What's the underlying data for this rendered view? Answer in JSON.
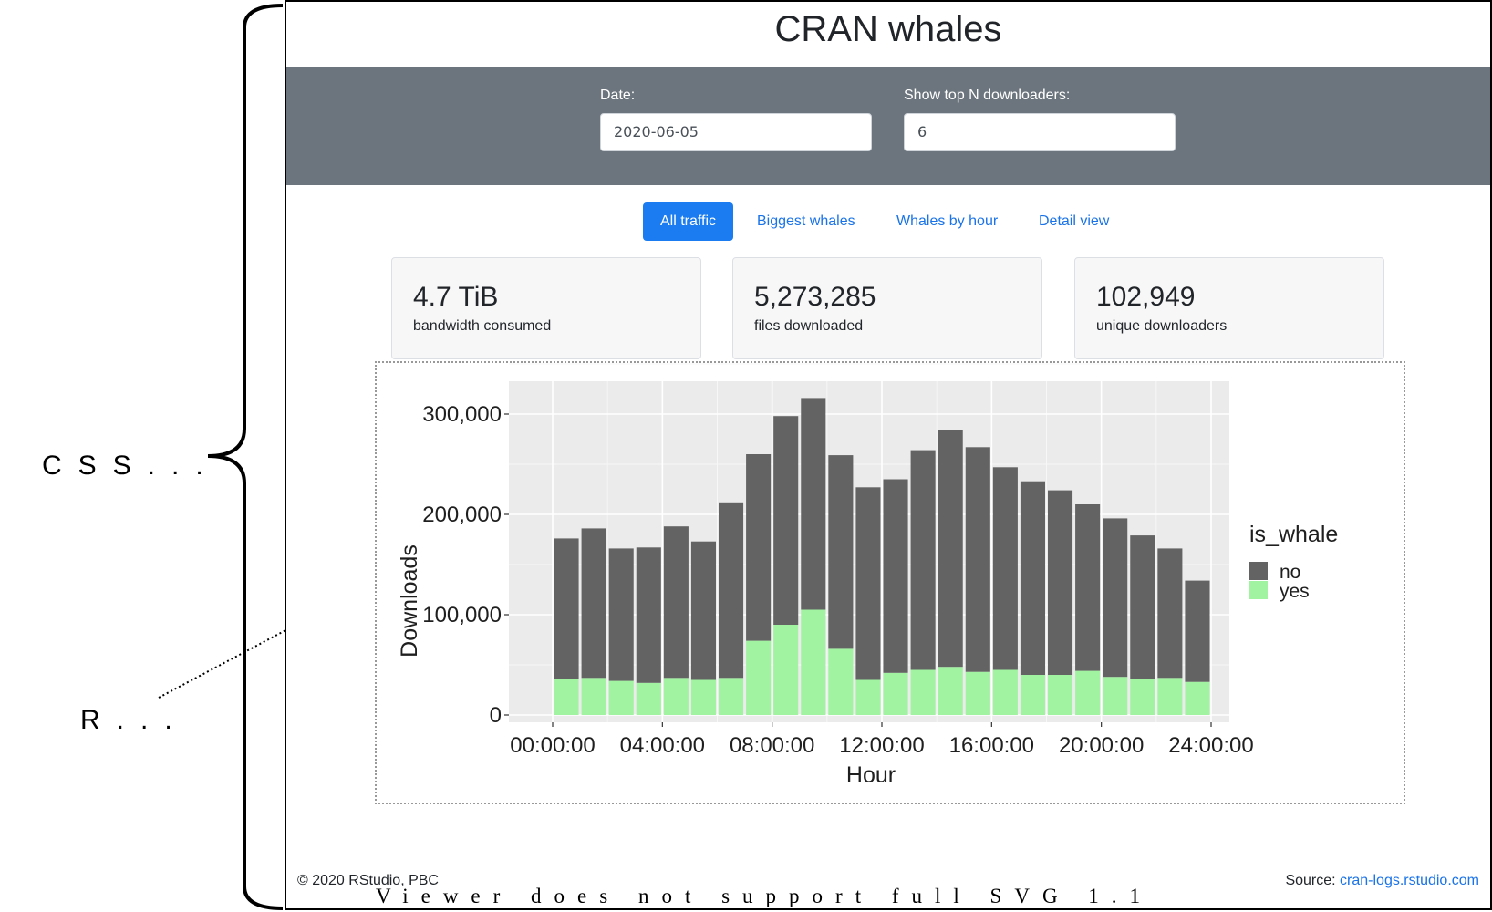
{
  "annotations": {
    "css": "CSS...",
    "r": "R..."
  },
  "app": {
    "title": "CRAN whales",
    "date_label": "Date:",
    "date_value": "2020-06-05",
    "topn_label": "Show top N downloaders:",
    "topn_value": "6",
    "tabs": [
      "All traffic",
      "Biggest whales",
      "Whales by hour",
      "Detail view"
    ],
    "active_tab": "All traffic",
    "cards": [
      {
        "value": "4.7 TiB",
        "label": "bandwidth consumed"
      },
      {
        "value": "5,273,285",
        "label": "files downloaded"
      },
      {
        "value": "102,949",
        "label": "unique downloaders"
      }
    ],
    "footer": {
      "copyright": "© 2020 RStudio, PBC",
      "svg_warning": "Viewer does not support full SVG 1.1",
      "source_label": "Source:",
      "source_link": "cran-logs.rstudio.com"
    }
  },
  "chart_data": {
    "type": "bar",
    "stacked": true,
    "xlabel": "Hour",
    "ylabel": "Downloads",
    "ylim": [
      0,
      330000
    ],
    "xlim": [
      -1,
      24
    ],
    "yticks": [
      0,
      100000,
      200000,
      300000
    ],
    "ytick_labels": [
      "0",
      "100,000",
      "200,000",
      "300,000"
    ],
    "xticks": [
      0,
      4,
      8,
      12,
      16,
      20,
      24
    ],
    "xtick_labels": [
      "00:00:00",
      "04:00:00",
      "08:00:00",
      "12:00:00",
      "16:00:00",
      "20:00:00",
      "24:00:00"
    ],
    "legend_title": "is_whale",
    "legend_position": "right",
    "x": [
      0.5,
      1.5,
      2.5,
      3.5,
      4.5,
      5.5,
      6.5,
      7.5,
      8.5,
      9.5,
      10.5,
      11.5,
      12.5,
      13.5,
      14.5,
      15.5,
      16.5,
      17.5,
      18.5,
      19.5,
      20.5,
      21.5,
      22.5,
      23.5
    ],
    "series": [
      {
        "name": "yes",
        "color": "#a1f2a1",
        "values": [
          36000,
          37000,
          34000,
          32000,
          37000,
          35000,
          37000,
          74000,
          90000,
          105000,
          66000,
          35000,
          42000,
          45000,
          48000,
          43000,
          45000,
          40000,
          40000,
          44000,
          38000,
          36000,
          37000,
          33000
        ]
      },
      {
        "name": "no",
        "color": "#636363",
        "values": [
          140000,
          149000,
          132000,
          135000,
          151000,
          138000,
          175000,
          186000,
          208000,
          211000,
          193000,
          192000,
          193000,
          219000,
          236000,
          224000,
          202000,
          193000,
          184000,
          166000,
          158000,
          143000,
          129000,
          101000
        ]
      }
    ],
    "grid": true,
    "panel_background": "#ebebeb"
  }
}
